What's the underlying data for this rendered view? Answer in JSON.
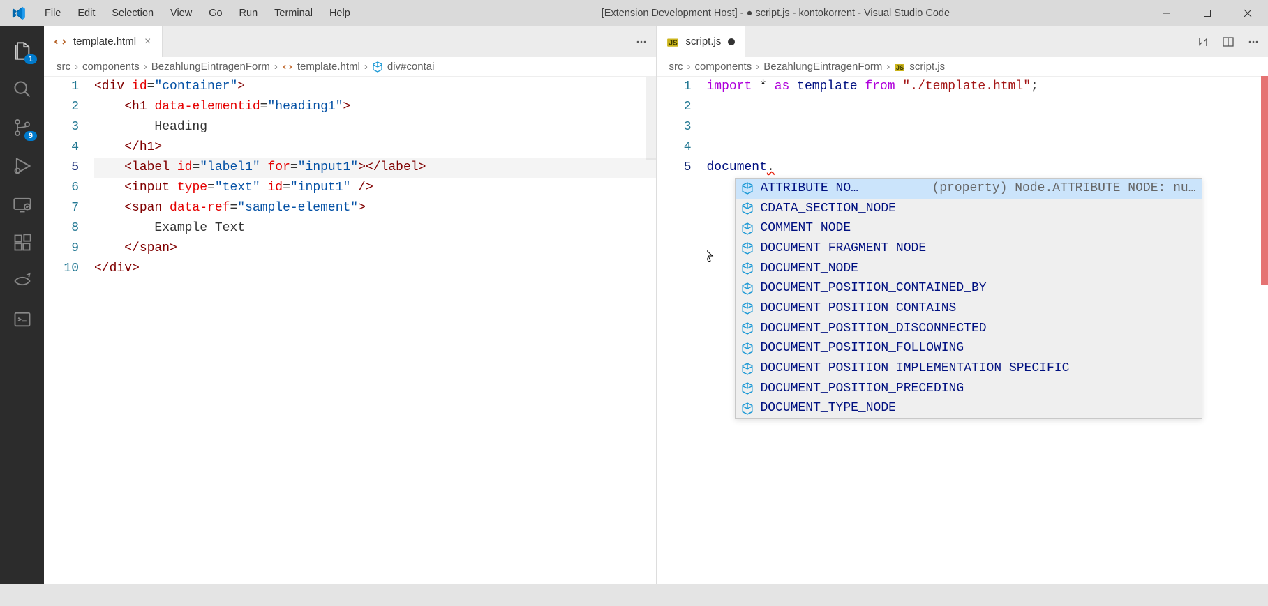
{
  "titlebar": {
    "menu": [
      "File",
      "Edit",
      "Selection",
      "View",
      "Go",
      "Run",
      "Terminal",
      "Help"
    ],
    "title": "[Extension Development Host] - ● script.js - kontokorrent - Visual Studio Code"
  },
  "activity_bar": {
    "explorer_badge": "1",
    "scm_badge": "9"
  },
  "editor_left": {
    "tab": {
      "label": "template.html"
    },
    "breadcrumbs": [
      "src",
      "components",
      "BezahlungEintragenForm",
      "template.html",
      "div#contai"
    ],
    "line_numbers": [
      "1",
      "2",
      "3",
      "4",
      "5",
      "6",
      "7",
      "8",
      "9",
      "10"
    ],
    "active_line": 5,
    "code": {
      "l1": {
        "open": "<div ",
        "attr1": "id",
        "eq": "=",
        "val1": "\"container\"",
        "close": ">"
      },
      "l2": {
        "open": "<h1 ",
        "attr1": "data-elementid",
        "eq": "=",
        "val1": "\"heading1\"",
        "close": ">"
      },
      "l3": {
        "text": "Heading"
      },
      "l4": {
        "close": "</h1>"
      },
      "l5": {
        "open": "<label ",
        "attr1": "id",
        "eq": "=",
        "val1": "\"label1\"",
        "sp": " ",
        "attr2": "for",
        "val2": "\"input1\"",
        "close": ">",
        "closetag": "</label>"
      },
      "l6": {
        "open": "<input ",
        "attr1": "type",
        "eq": "=",
        "val1": "\"text\"",
        "sp": " ",
        "attr2": "id",
        "val2": "\"input1\"",
        "close": " />"
      },
      "l7": {
        "open": "<span ",
        "attr1": "data-ref",
        "eq": "=",
        "val1": "\"sample-element\"",
        "close": ">"
      },
      "l8": {
        "text": "Example Text"
      },
      "l9": {
        "close": "</span>"
      },
      "l10": {
        "close": "</div>"
      }
    }
  },
  "editor_right": {
    "tab": {
      "label": "script.js"
    },
    "breadcrumbs": [
      "src",
      "components",
      "BezahlungEintragenForm",
      "script.js"
    ],
    "line_numbers": [
      "1",
      "2",
      "3",
      "4",
      "5"
    ],
    "active_line": 5,
    "code": {
      "l1": {
        "kw": "import",
        "star": " * ",
        "as": "as",
        "sp": " ",
        "ident": "template",
        "sp2": " ",
        "from": "from",
        "sp3": " ",
        "str": "\"./template.html\"",
        "semi": ";"
      },
      "l5": {
        "ident": "document",
        "dot": "."
      }
    },
    "suggestions": [
      {
        "label": "ATTRIBUTE_NO…",
        "detail": "(property) Node.ATTRIBUTE_NODE: nu…",
        "selected": true
      },
      {
        "label": "CDATA_SECTION_NODE"
      },
      {
        "label": "COMMENT_NODE"
      },
      {
        "label": "DOCUMENT_FRAGMENT_NODE"
      },
      {
        "label": "DOCUMENT_NODE"
      },
      {
        "label": "DOCUMENT_POSITION_CONTAINED_BY"
      },
      {
        "label": "DOCUMENT_POSITION_CONTAINS"
      },
      {
        "label": "DOCUMENT_POSITION_DISCONNECTED"
      },
      {
        "label": "DOCUMENT_POSITION_FOLLOWING"
      },
      {
        "label": "DOCUMENT_POSITION_IMPLEMENTATION_SPECIFIC"
      },
      {
        "label": "DOCUMENT_POSITION_PRECEDING"
      },
      {
        "label": "DOCUMENT_TYPE_NODE"
      }
    ]
  }
}
